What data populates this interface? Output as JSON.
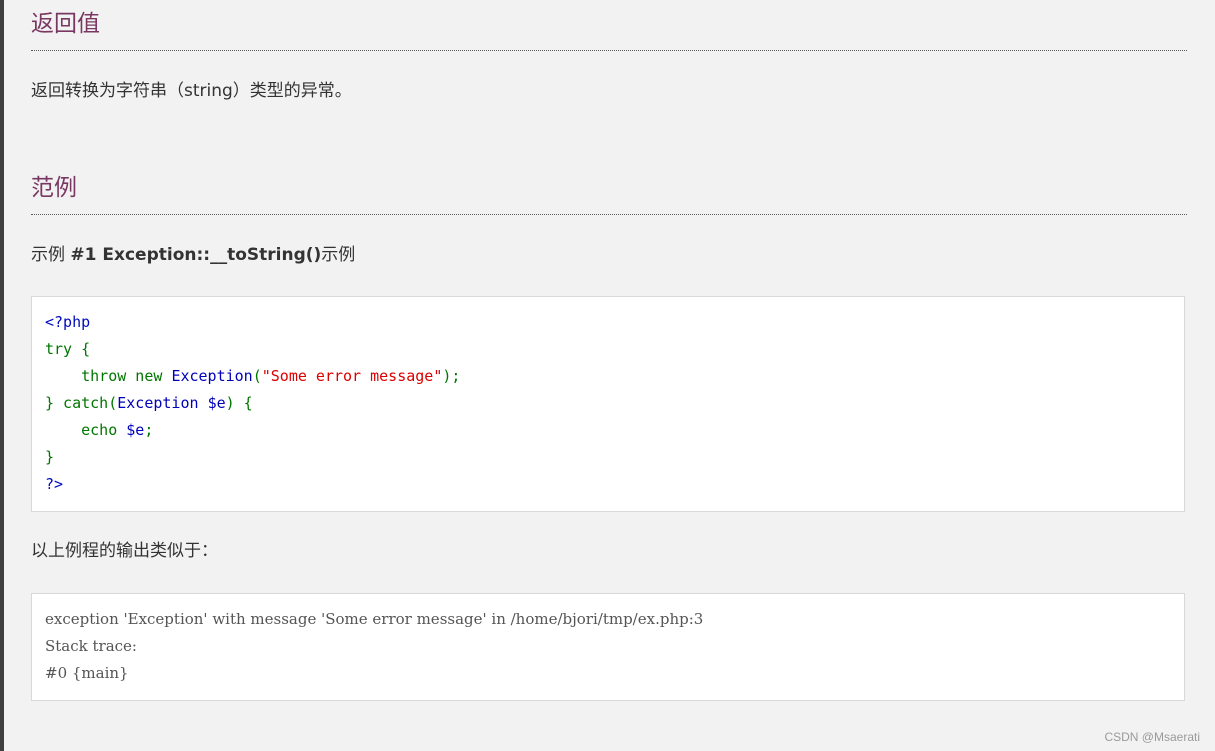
{
  "sections": {
    "return_values": {
      "heading": "返回值",
      "text": "返回转换为字符串（string）类型的异常。"
    },
    "examples": {
      "heading": "范例",
      "example_prefix": "示例 ",
      "example_title": "#1 Exception::__toString()",
      "example_suffix": "示例"
    }
  },
  "code": {
    "open_tag": "<?php",
    "try_kw": "try",
    "brace_open": " {",
    "indent": "    ",
    "throw_kw": "throw",
    "new_kw": " new ",
    "exception_cls": "Exception",
    "paren_open": "(",
    "string_literal": "\"Some error message\"",
    "paren_close_semi": ");",
    "close_brace": "}",
    "catch_kw": " catch(",
    "catch_cls": "Exception",
    "space": " ",
    "var_e": "$e",
    "catch_close": ") {",
    "echo_kw": "echo",
    "echo_var": " $e",
    "semi": ";",
    "close_tag": "?>"
  },
  "output_intro": "以上例程的输出类似于：",
  "output": {
    "lines": [
      "exception 'Exception' with message 'Some error message' in /home/bjori/tmp/ex.php:3",
      "Stack trace:",
      "#0 {main}"
    ]
  },
  "watermark": "CSDN @Msaerati"
}
